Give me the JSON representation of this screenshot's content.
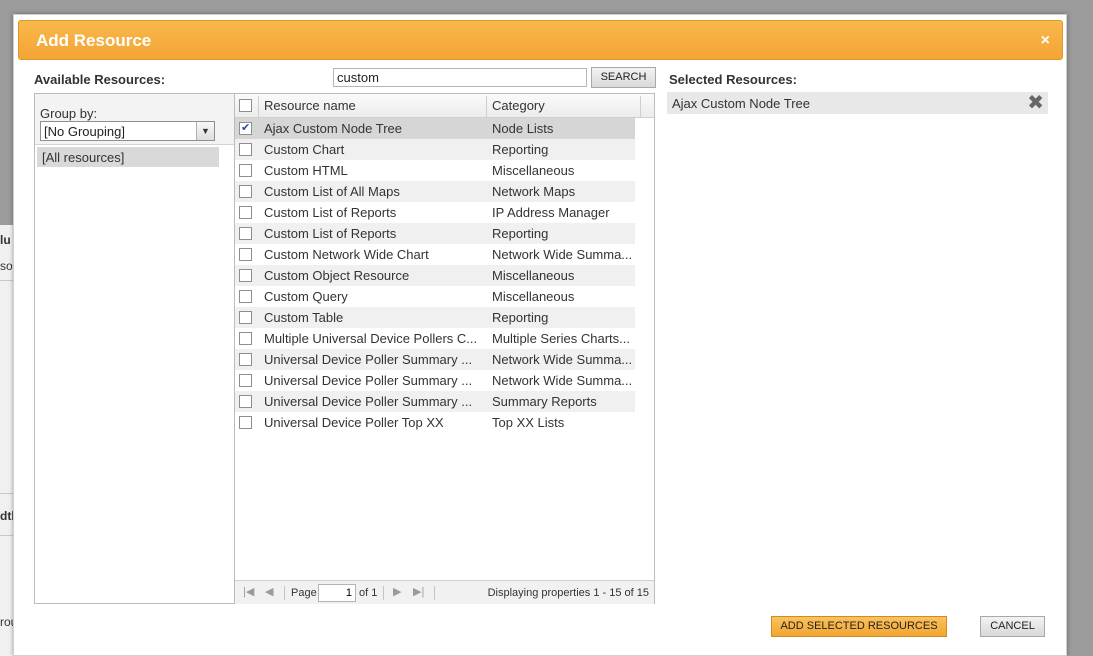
{
  "background": {
    "fragments": [
      "lu",
      "so",
      "dtl",
      "rou"
    ]
  },
  "dialog": {
    "title": "Add Resource",
    "close_glyph": "×"
  },
  "available": {
    "label": "Available Resources:",
    "search_value": "custom",
    "search_button": "SEARCH"
  },
  "group": {
    "label": "Group by:",
    "selected": "[No Grouping]",
    "items": [
      "[All resources]"
    ]
  },
  "grid": {
    "columns": [
      "Resource name",
      "Category"
    ],
    "rows": [
      {
        "name": "Ajax Custom Node Tree",
        "category": "Node Lists",
        "checked": true
      },
      {
        "name": "Custom Chart",
        "category": "Reporting",
        "checked": false
      },
      {
        "name": "Custom HTML",
        "category": "Miscellaneous",
        "checked": false
      },
      {
        "name": "Custom List of All Maps",
        "category": "Network Maps",
        "checked": false
      },
      {
        "name": "Custom List of Reports",
        "category": "IP Address Manager",
        "checked": false
      },
      {
        "name": "Custom List of Reports",
        "category": "Reporting",
        "checked": false
      },
      {
        "name": "Custom Network Wide Chart",
        "category": "Network Wide Summa...",
        "checked": false
      },
      {
        "name": "Custom Object Resource",
        "category": "Miscellaneous",
        "checked": false
      },
      {
        "name": "Custom Query",
        "category": "Miscellaneous",
        "checked": false
      },
      {
        "name": "Custom Table",
        "category": "Reporting",
        "checked": false
      },
      {
        "name": "Multiple Universal Device Pollers C...",
        "category": "Multiple Series Charts...",
        "checked": false
      },
      {
        "name": "Universal Device Poller Summary ...",
        "category": "Network Wide Summa...",
        "checked": false
      },
      {
        "name": "Universal Device Poller Summary ...",
        "category": "Network Wide Summa...",
        "checked": false
      },
      {
        "name": "Universal Device Poller Summary ...",
        "category": "Summary Reports",
        "checked": false
      },
      {
        "name": "Universal Device Poller Top XX",
        "category": "Top XX Lists",
        "checked": false
      }
    ]
  },
  "pager": {
    "page_label": "Page",
    "page_value": "1",
    "of_label": "of 1",
    "display_text": "Displaying properties 1 - 15 of 15"
  },
  "selected": {
    "label": "Selected Resources:",
    "items": [
      "Ajax Custom Node Tree"
    ]
  },
  "buttons": {
    "add": "ADD SELECTED RESOURCES",
    "cancel": "CANCEL"
  }
}
